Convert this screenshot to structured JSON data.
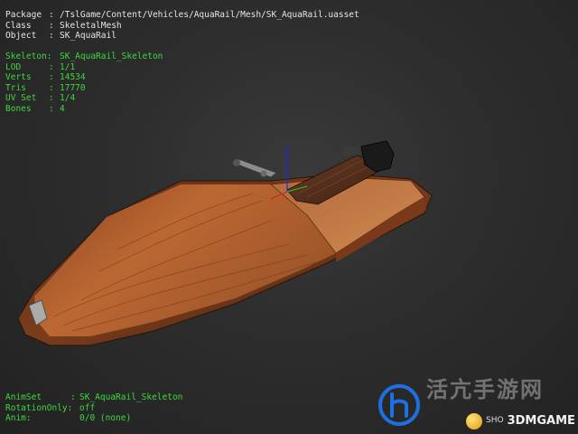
{
  "header_info": [
    {
      "key": "Package",
      "sep": ":",
      "value": "/TslGame/Content/Vehicles/AquaRail/Mesh/SK_AquaRail.uasset"
    },
    {
      "key": "Class",
      "sep": ":",
      "value": "SkeletalMesh"
    },
    {
      "key": "Object",
      "sep": ":",
      "value": "SK_AquaRail"
    }
  ],
  "mesh_info": [
    {
      "key": "Skeleton:",
      "sep": "",
      "value": "SK_AquaRail_Skeleton"
    },
    {
      "key": "LOD",
      "sep": ":",
      "value": "1/1"
    },
    {
      "key": "Verts",
      "sep": ":",
      "value": "14534"
    },
    {
      "key": "Tris",
      "sep": ":",
      "value": "17770"
    },
    {
      "key": "UV Set",
      "sep": ":",
      "value": "1/4"
    },
    {
      "key": "Bones",
      "sep": ":",
      "value": "4"
    }
  ],
  "anim_info": [
    {
      "key": "AnimSet",
      "sep": ":",
      "value": "SK_AquaRail_Skeleton"
    },
    {
      "key": "RotationOnly:",
      "sep": "",
      "value": "off"
    },
    {
      "key": "Anim:",
      "sep": "",
      "value": "0/0 (none)"
    }
  ],
  "watermark": {
    "cn_text": "活亢手游网",
    "brand_small": "SHO",
    "brand_big": "3DMGAME"
  },
  "colors": {
    "label_white": "#e6e6e6",
    "label_green": "#3cd93c",
    "background": "#2e2e2e",
    "hull_wood": "#a0522d",
    "axis_blue": "#2222ff"
  },
  "icons": {
    "watermark_logo": "phone-circle-logo-icon",
    "brand_logo": "gold-ball-logo-icon"
  }
}
